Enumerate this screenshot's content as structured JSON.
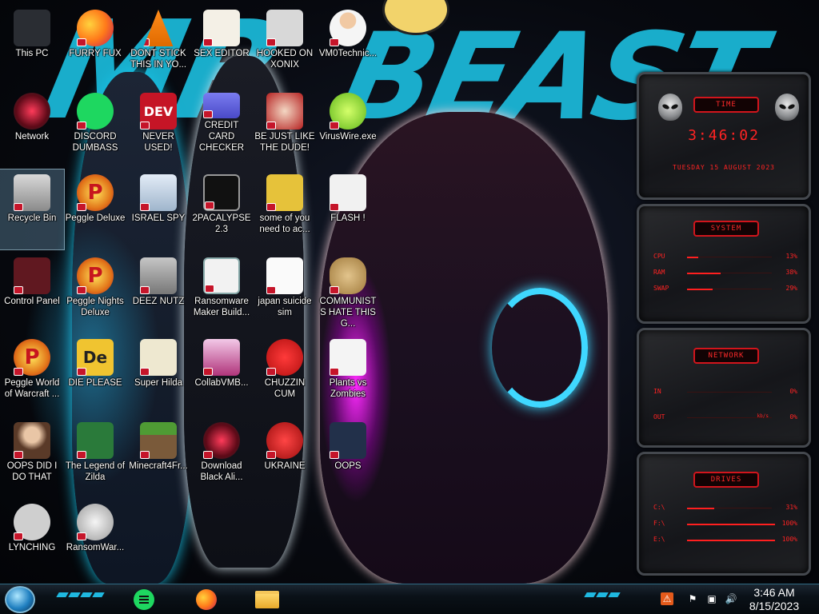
{
  "desktop_icons": [
    {
      "label": "This PC",
      "icon": "computer-icon"
    },
    {
      "label": "FURRY FUX",
      "icon": "firefox-icon"
    },
    {
      "label": "DONT STICK THIS IN YO...",
      "icon": "vlc-cone-icon"
    },
    {
      "label": "SEX EDITOR",
      "icon": "xd-editor-icon"
    },
    {
      "label": "HOOKED ON XONIX",
      "icon": "xonix-game-icon"
    },
    {
      "label": "VM0Technic...",
      "icon": "doctor-icon"
    },
    {
      "label": "Network",
      "icon": "network-icon"
    },
    {
      "label": "DISCORD DUMBASS",
      "icon": "chat-icon"
    },
    {
      "label": "NEVER USED!",
      "icon": "dev-icon",
      "glyph": "DEV"
    },
    {
      "label": "CREDIT CARD CHECKER",
      "icon": "credit-card-icon"
    },
    {
      "label": "BE JUST LIKE THE DUDE!",
      "icon": "santa-icon"
    },
    {
      "label": "VirusWire.exe",
      "icon": "lime-icon"
    },
    {
      "label": "Recycle Bin",
      "icon": "recycle-bin-icon"
    },
    {
      "label": "Peggle Deluxe",
      "icon": "peggle-icon",
      "glyph": "P"
    },
    {
      "label": "ISRAEL SPY",
      "icon": "network-share-icon"
    },
    {
      "label": "2PACALYPSE 2.3",
      "icon": "terminal-icon"
    },
    {
      "label": "some of you need to ac...",
      "icon": "beaver-icon"
    },
    {
      "label": "FLASH !",
      "icon": "flash-icon"
    },
    {
      "label": "Control Panel",
      "icon": "control-panel-icon"
    },
    {
      "label": "Peggle Nights Deluxe",
      "icon": "peggle-icon",
      "glyph": "P"
    },
    {
      "label": "DEEZ NUTZ",
      "icon": "windows-stack-icon"
    },
    {
      "label": "Ransomware Maker Build...",
      "icon": "app-window-icon"
    },
    {
      "label": "japan suicide sim",
      "icon": "document-icon"
    },
    {
      "label": "COMMUNISTS HATE THIS G...",
      "icon": "money-bag-icon"
    },
    {
      "label": "Peggle World of Warcraft ...",
      "icon": "peggle-icon",
      "glyph": "P"
    },
    {
      "label": "DIE PLEASE",
      "icon": "director-icon",
      "glyph": "De"
    },
    {
      "label": "Super Hilda",
      "icon": "pixel-game-icon"
    },
    {
      "label": "CollabVMB...",
      "icon": "monitor-icon"
    },
    {
      "label": "CHUZZIN CUM",
      "icon": "chuzzle-icon"
    },
    {
      "label": "Plants vs Zombies",
      "icon": "plant-icon"
    },
    {
      "label": "OOPS DID I DO THAT",
      "icon": "portrait-icon"
    },
    {
      "label": "The Legend of Zilda",
      "icon": "zelda-icon"
    },
    {
      "label": "Minecraft4Fr...",
      "icon": "grass-block-icon"
    },
    {
      "label": "Download Black Ali...",
      "icon": "network-icon"
    },
    {
      "label": "UKRAINE",
      "icon": "radiation-icon"
    },
    {
      "label": "OOPS",
      "icon": "oops-icon"
    },
    {
      "label": "LYNCHING",
      "icon": "rope-icon"
    },
    {
      "label": "RansomWar...",
      "icon": "skull-icon"
    }
  ],
  "widget": {
    "time_title": "TIME",
    "time": "3:46:02",
    "date": "TUESDAY 15 AUGUST 2023",
    "system_title": "SYSTEM",
    "system_rows": [
      {
        "key": "CPU",
        "value": "13%",
        "level": 0.13
      },
      {
        "key": "RAM",
        "value": "38%",
        "level": 0.38
      },
      {
        "key": "SWAP",
        "value": "29%",
        "level": 0.29
      }
    ],
    "network_title": "NETWORK",
    "network_rows": [
      {
        "key": "IN",
        "value": "0%"
      },
      {
        "key": "OUT",
        "value": "0%",
        "extra": "kb/s"
      }
    ],
    "drives_title": "DRIVES",
    "drive_rows": [
      {
        "key": "C:\\",
        "value": "31%",
        "level": 0.31
      },
      {
        "key": "F:\\",
        "value": "100%",
        "level": 1.0
      },
      {
        "key": "E:\\",
        "value": "100%",
        "level": 1.0
      }
    ]
  },
  "wallpaper": {
    "text": "MRBEAST",
    "accent": "#1bb6d6"
  },
  "taskbar": {
    "apps": [
      "spotify-like-chat-icon",
      "firefox-icon",
      "file-explorer-icon"
    ],
    "tray": [
      "flame-icon",
      "flag-icon",
      "network-tray-icon",
      "volume-icon"
    ],
    "time": "3:46 AM",
    "date": "8/15/2023"
  },
  "colors": {
    "accent_red": "#ff2323",
    "taskbar_accent": "#1fb8e0"
  }
}
